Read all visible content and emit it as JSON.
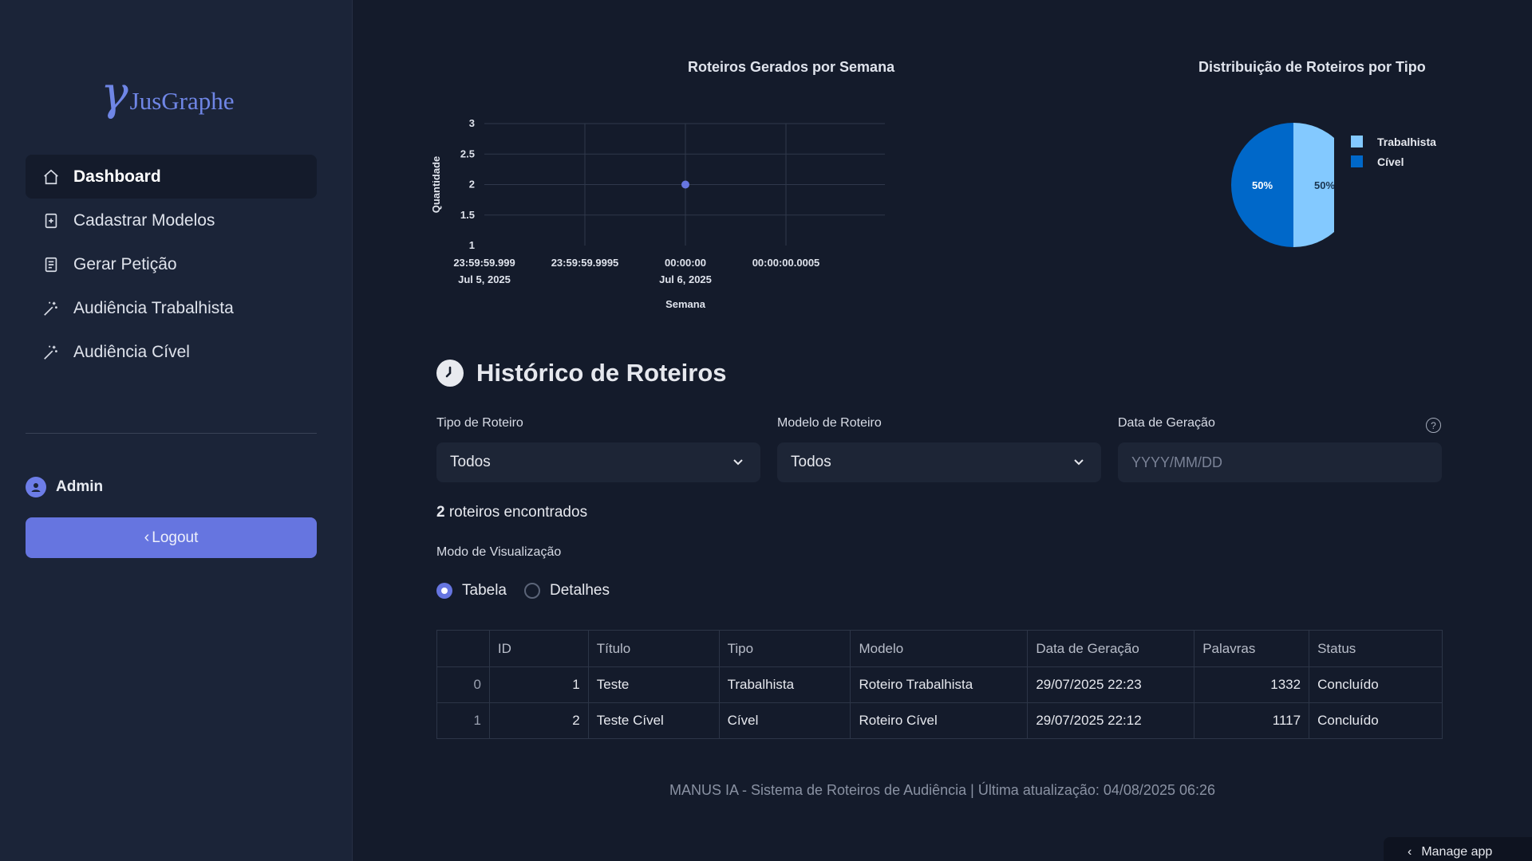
{
  "sidebar": {
    "logo_symbol": "γ",
    "logo_text": "JusGraphe",
    "items": [
      {
        "label": "Dashboard",
        "icon": "home-icon"
      },
      {
        "label": "Cadastrar Modelos",
        "icon": "file-plus-icon"
      },
      {
        "label": "Gerar Petição",
        "icon": "document-icon"
      },
      {
        "label": "Audiência Trabalhista",
        "icon": "magic-wand-icon"
      },
      {
        "label": "Audiência Cível",
        "icon": "magic-wand-icon"
      }
    ],
    "user_name": "Admin",
    "logout_label": "Logout"
  },
  "charts": {
    "weekly_title": "Roteiros Gerados por Semana",
    "pie_title": "Distribuição de Roteiros por Tipo"
  },
  "chart_data": [
    {
      "type": "scatter",
      "title": "Roteiros Gerados por Semana",
      "xlabel": "Semana",
      "ylabel": "Quantidade",
      "x_ticks": [
        {
          "line1": "23:59:59.999",
          "line2": "Jul 5, 2025"
        },
        {
          "line1": "23:59:59.9995",
          "line2": ""
        },
        {
          "line1": "00:00:00",
          "line2": "Jul 6, 2025"
        },
        {
          "line1": "00:00:00.0005",
          "line2": ""
        }
      ],
      "y_ticks": [
        "3",
        "2.5",
        "2",
        "1.5",
        "1"
      ],
      "ylim": [
        1,
        3
      ],
      "points": [
        {
          "x": "2025-07-06 00:00:00",
          "y": 2
        }
      ],
      "grid": true,
      "point_color": "#6675e0"
    },
    {
      "type": "pie",
      "title": "Distribuição de Roteiros por Tipo",
      "slices": [
        {
          "label": "Trabalhista",
          "value": 50,
          "text": "50%",
          "color": "#83c9ff"
        },
        {
          "label": "Cível",
          "value": 50,
          "text": "50%",
          "color": "#0068c9"
        }
      ],
      "legend_position": "top-right"
    }
  ],
  "history": {
    "title": "Histórico de Roteiros",
    "filters": {
      "tipo_label": "Tipo de Roteiro",
      "tipo_value": "Todos",
      "modelo_label": "Modelo de Roteiro",
      "modelo_value": "Todos",
      "data_label": "Data de Geração",
      "data_placeholder": "YYYY/MM/DD"
    },
    "found_count": "2",
    "found_text": "roteiros encontrados",
    "view_mode_label": "Modo de Visualização",
    "view_options": [
      {
        "label": "Tabela",
        "checked": true
      },
      {
        "label": "Detalhes",
        "checked": false
      }
    ],
    "table": {
      "columns": [
        "",
        "ID",
        "Título",
        "Tipo",
        "Modelo",
        "Data de Geração",
        "Palavras",
        "Status"
      ],
      "rows": [
        [
          "0",
          "1",
          "Teste",
          "Trabalhista",
          "Roteiro Trabalhista",
          "29/07/2025 22:23",
          "1332",
          "Concluído"
        ],
        [
          "1",
          "2",
          "Teste Cível",
          "Cível",
          "Roteiro Cível",
          "29/07/2025 22:12",
          "1117",
          "Concluído"
        ]
      ]
    }
  },
  "footer": "MANUS IA - Sistema de Roteiros de Audiência | Última atualização: 04/08/2025 06:26",
  "manage_app_label": "Manage app",
  "colors": {
    "accent": "#6675e0",
    "background": "#141b2b",
    "sidebar": "#1b2438"
  }
}
